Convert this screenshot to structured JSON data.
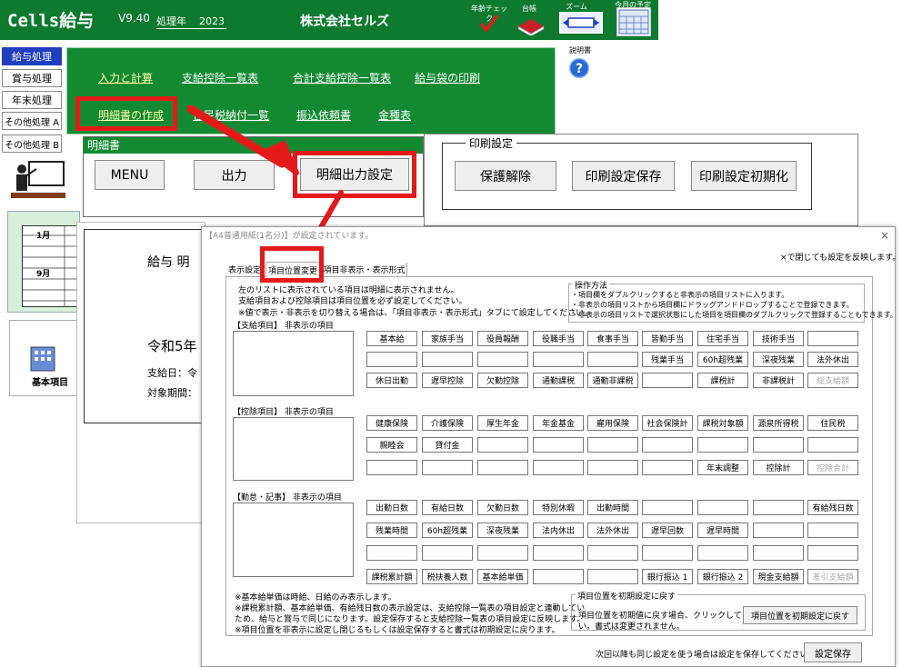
{
  "app": {
    "title": "Cells給与",
    "version": "V9.40",
    "year_label": "処理年",
    "year": "2023",
    "company": "株式会社セルズ"
  },
  "toolbar": {
    "age_check": "年齢チェック",
    "ledger": "台帳",
    "zoom": "ズーム",
    "monthly_plan": "今月の予定",
    "manual": "説明書"
  },
  "left_menu": [
    "給与処理",
    "賞与処理",
    "年末処理",
    "その他処理 A",
    "その他処理 B"
  ],
  "green_links": {
    "row1": [
      "入力と計算",
      "支給控除一覧表",
      "合計支給控除一覧表",
      "給与袋の印刷"
    ],
    "row2": [
      "明細書の作成",
      "住民税納付一覧",
      "振込依頼書",
      "金種表"
    ]
  },
  "meisai_panel": {
    "title": "明細書",
    "buttons": [
      "MENU",
      "出力",
      "明細出力設定"
    ]
  },
  "print_settings": {
    "title": "印刷設定",
    "buttons": [
      "保護解除",
      "印刷設定保存",
      "印刷設定初期化"
    ]
  },
  "calendar": {
    "months": [
      "1月",
      "9月"
    ]
  },
  "basic_item": "基本項目",
  "bg_doc": {
    "title": "給与 明",
    "era": "令和5年",
    "pay_date": "支給日：令",
    "period": "対象期間："
  },
  "dialog": {
    "title": "【A4普通用紙(1名分)】が設定されています。",
    "close": "×",
    "note_top_right": "×で閉じても設定を反映します。",
    "tabs": [
      "表示設定",
      "項目位置変更",
      "項目非表示・表示形式"
    ],
    "instructions": [
      "左のリストに表示されている項目は明細に表示されません。",
      "支給項目および控除項目は項目位置を必ず設定してください。",
      "※値で表示・非表示を切り替える場合は、「項目非表示・表示形式」タブにて設定してください。"
    ],
    "operation": {
      "title": "操作方法",
      "lines": [
        "・項目欄をダブルクリックすると非表示の項目リストに入ります。",
        "・非表示の項目リストから項目欄にドラッグアンドドロップすることで登録できます。",
        "・非表示の項目リストで選択状態にした項目を項目欄のダブルクリックで登録することもできます。"
      ]
    },
    "sections": [
      {
        "label": "【支給項目】 非表示の項目",
        "rows": [
          [
            "基本給",
            "家族手当",
            "役員報酬",
            "役職手当",
            "食事手当",
            "皆勤手当",
            "住宅手当",
            "技術手当",
            ""
          ],
          [
            "",
            "",
            "",
            "",
            "",
            "",
            "残業手当",
            "60h超残業",
            "深夜残業",
            "法外休出"
          ],
          [
            "休日出勤",
            "遅早控除",
            "欠勤控除",
            "通勤課税",
            "通勤非課税",
            "",
            "課税計",
            "非課税計",
            "総支給額"
          ]
        ]
      },
      {
        "label": "【控除項目】 非表示の項目",
        "rows": [
          [
            "健康保険",
            "介護保険",
            "厚生年金",
            "年金基金",
            "雇用保険",
            "社会保険計",
            "課税対象額",
            "源泉所得税",
            "住民税"
          ],
          [
            "親睦会",
            "貸付金",
            "",
            "",
            "",
            "",
            "",
            "",
            ""
          ],
          [
            "",
            "",
            "",
            "",
            "",
            "",
            "年末調整",
            "控除計",
            "控除合計"
          ]
        ]
      },
      {
        "label": "【勤怠・記事】 非表示の項目",
        "rows": [
          [
            "出勤日数",
            "有給日数",
            "欠勤日数",
            "特別休暇",
            "出勤時間",
            "",
            "",
            "",
            "有給残日数"
          ],
          [
            "残業時間",
            "60h超残業",
            "深夜残業",
            "法内休出",
            "法外休出",
            "遅早回数",
            "遅早時間",
            "",
            ""
          ],
          [
            "",
            "",
            "",
            "",
            "",
            "",
            "",
            "",
            ""
          ],
          [
            "課税累計額",
            "税扶養人数",
            "基本給単価",
            "",
            "",
            "銀行振込 1",
            "銀行振込 2",
            "現金支給額",
            "差引支給額"
          ]
        ]
      }
    ],
    "footnotes": [
      "※基本給単価は時給、日給のみ表示します。",
      "※課税累計額、基本給単価、有給残日数の表示設定は、支給控除一覧表の項目設定と連動してい",
      "ため、給与と賞与で同じになります。設定保存すると支給控除一覧表の項目設定に反映します。",
      "※項目位置を非表示に設定し閉じるもしくは設定保存すると書式は初期設定に戻ります。"
    ],
    "reset": {
      "title": "項目位置を初期設定に戻す",
      "desc1": "項目位置を初期値に戻す場合、クリックしてくださ",
      "desc2": "い。書式は変更されません。",
      "button": "項目位置を初期設定に戻す"
    },
    "bottom_note": "次回以降も同じ設定を使う場合は設定を保存してください。⇒",
    "save_button": "設定保存"
  },
  "colors": {
    "green": "#138a32",
    "link_yellow": "#ffffa8",
    "highlight_red": "#e41a1a",
    "menu_active": "#1f3fbf"
  }
}
